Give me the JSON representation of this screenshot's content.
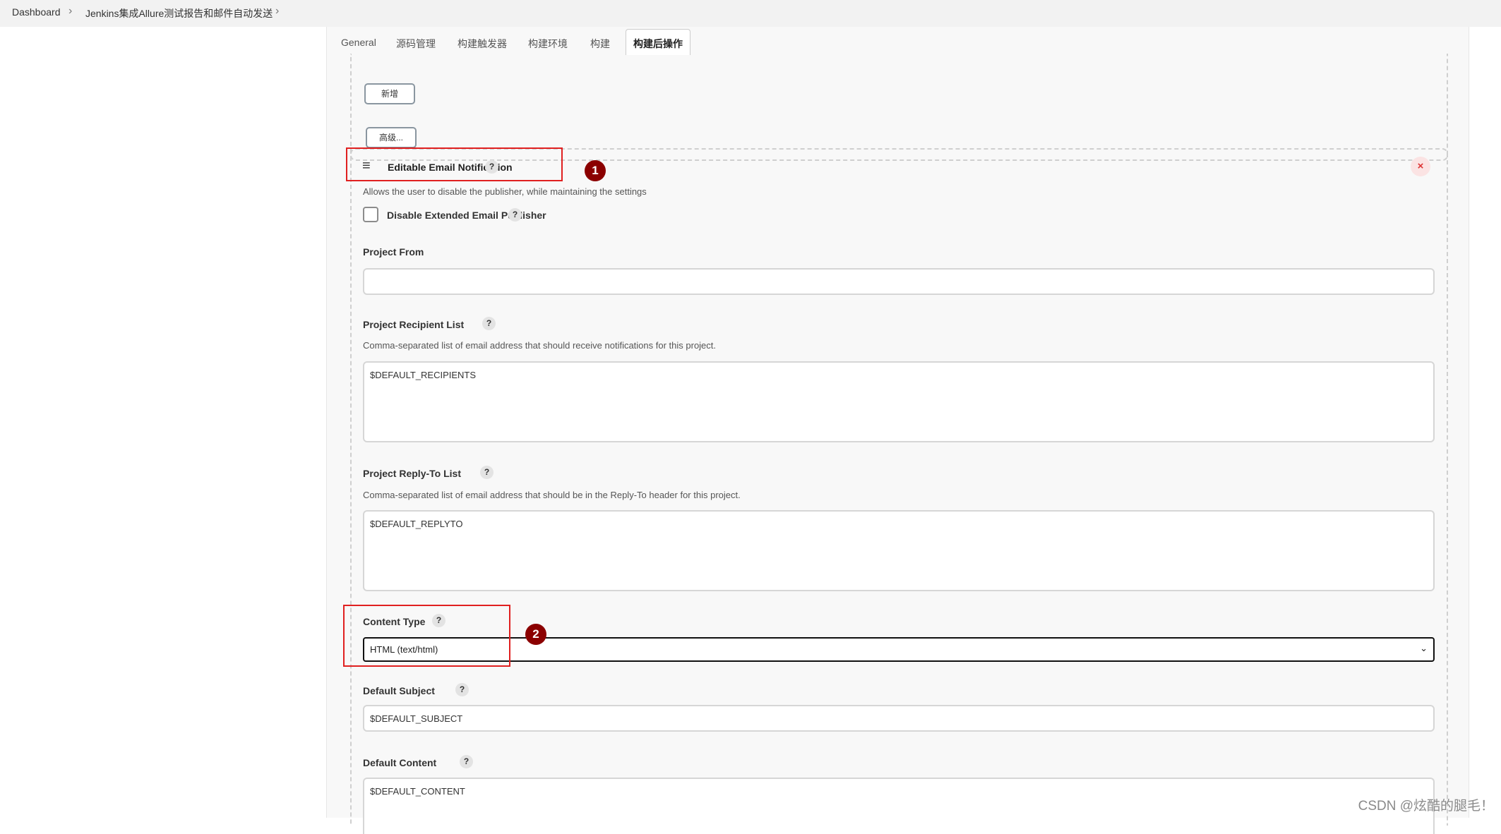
{
  "breadcrumb": {
    "items": [
      "Dashboard",
      "Jenkins集成Allure测试报告和邮件自动发送"
    ]
  },
  "tabs": [
    "General",
    "源码管理",
    "构建触发器",
    "构建环境",
    "构建",
    "构建后操作"
  ],
  "active_tab": "构建后操作",
  "top_section": {
    "add_button": "新增",
    "advanced_button": "高级..."
  },
  "email_section": {
    "title": "Editable Email Notification",
    "description": "Allows the user to disable the publisher, while maintaining the settings",
    "disable_checkbox_label": "Disable Extended Email Publisher",
    "close_icon": "×",
    "handle_icon": "≡",
    "help_icon": "?",
    "project_from": {
      "label": "Project From",
      "value": ""
    },
    "recipient_list": {
      "label": "Project Recipient List",
      "description": "Comma-separated list of email address that should receive notifications for this project.",
      "value": "$DEFAULT_RECIPIENTS"
    },
    "reply_to_list": {
      "label": "Project Reply-To List",
      "description": "Comma-separated list of email address that should be in the Reply-To header for this project.",
      "value": "$DEFAULT_REPLYTO"
    },
    "content_type": {
      "label": "Content Type",
      "value": "HTML (text/html)"
    },
    "default_subject": {
      "label": "Default Subject",
      "value": "$DEFAULT_SUBJECT"
    },
    "default_content": {
      "label": "Default Content",
      "value": "$DEFAULT_CONTENT"
    }
  },
  "annotations": [
    "1",
    "2"
  ],
  "watermark": "CSDN @炫酷的腿毛！",
  "colors": {
    "annotation_border": "#e02020",
    "annotation_badge": "#8b0000",
    "panel_bg": "#f8f8f8"
  }
}
